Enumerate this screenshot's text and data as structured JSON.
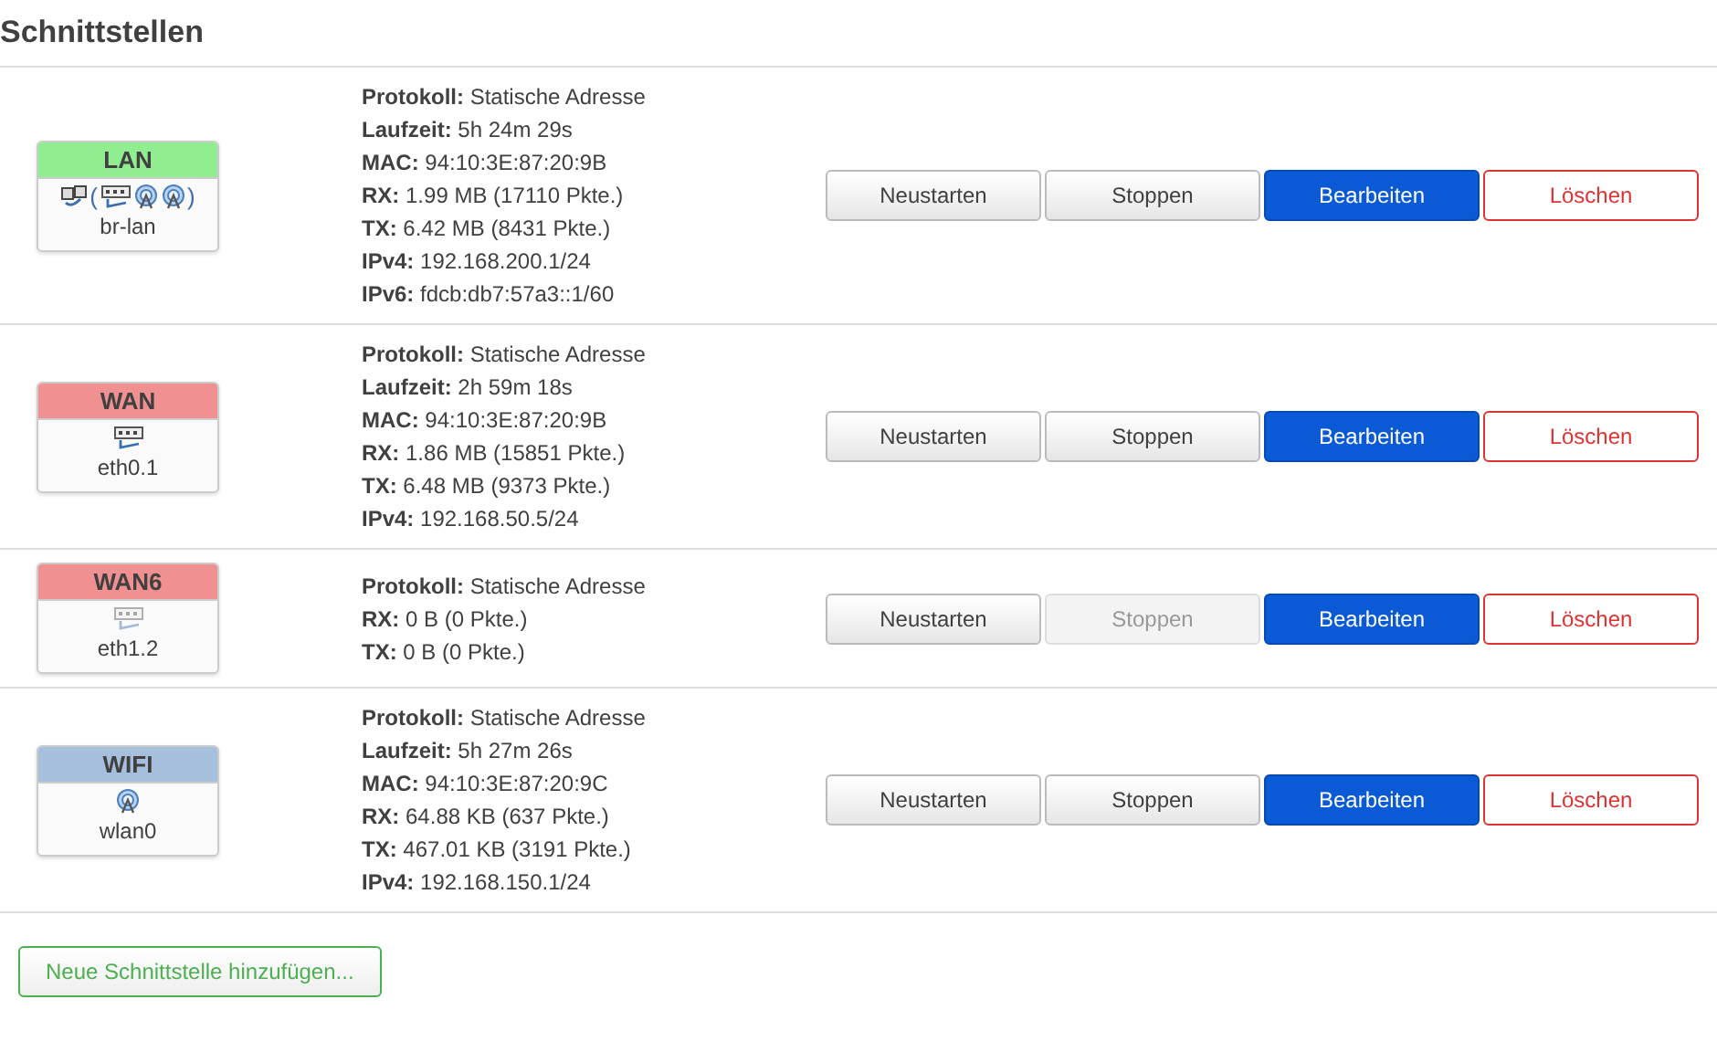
{
  "title": "Schnittstellen",
  "interfaces": [
    {
      "name": "LAN",
      "color": "#90ee90",
      "device": "br-lan",
      "icons": [
        {
          "kind": "bridge",
          "active": true
        },
        {
          "kind": "text",
          "text": "("
        },
        {
          "kind": "ethernet",
          "active": true
        },
        {
          "kind": "wifi",
          "active": true
        },
        {
          "kind": "wifi",
          "active": true
        },
        {
          "kind": "text",
          "text": ")"
        }
      ],
      "details": [
        {
          "label": "Protokoll:",
          "value": "Statische Adresse"
        },
        {
          "label": "Laufzeit:",
          "value": "5h 24m 29s"
        },
        {
          "label": "MAC:",
          "value": "94:10:3E:87:20:9B"
        },
        {
          "label": "RX:",
          "value": "1.99 MB (17110 Pkte.)"
        },
        {
          "label": "TX:",
          "value": "6.42 MB (8431 Pkte.)"
        },
        {
          "label": "IPv4:",
          "value": "192.168.200.1/24"
        },
        {
          "label": "IPv6:",
          "value": "fdcb:db7:57a3::1/60"
        }
      ],
      "buttons": [
        {
          "label": "Neustarten",
          "kind": "default",
          "disabled": false
        },
        {
          "label": "Stoppen",
          "kind": "default",
          "disabled": false
        },
        {
          "label": "Bearbeiten",
          "kind": "primary",
          "disabled": false
        },
        {
          "label": "Löschen",
          "kind": "danger",
          "disabled": false
        }
      ]
    },
    {
      "name": "WAN",
      "color": "#f09090",
      "device": "eth0.1",
      "icons": [
        {
          "kind": "ethernet",
          "active": true
        }
      ],
      "details": [
        {
          "label": "Protokoll:",
          "value": "Statische Adresse"
        },
        {
          "label": "Laufzeit:",
          "value": "2h 59m 18s"
        },
        {
          "label": "MAC:",
          "value": "94:10:3E:87:20:9B"
        },
        {
          "label": "RX:",
          "value": "1.86 MB (15851 Pkte.)"
        },
        {
          "label": "TX:",
          "value": "6.48 MB (9373 Pkte.)"
        },
        {
          "label": "IPv4:",
          "value": "192.168.50.5/24"
        }
      ],
      "buttons": [
        {
          "label": "Neustarten",
          "kind": "default",
          "disabled": false
        },
        {
          "label": "Stoppen",
          "kind": "default",
          "disabled": false
        },
        {
          "label": "Bearbeiten",
          "kind": "primary",
          "disabled": false
        },
        {
          "label": "Löschen",
          "kind": "danger",
          "disabled": false
        }
      ]
    },
    {
      "name": "WAN6",
      "color": "#f09090",
      "device": "eth1.2",
      "icons": [
        {
          "kind": "ethernet",
          "active": false
        }
      ],
      "details": [
        {
          "label": "Protokoll:",
          "value": "Statische Adresse"
        },
        {
          "label": "RX:",
          "value": "0 B (0 Pkte.)"
        },
        {
          "label": "TX:",
          "value": "0 B (0 Pkte.)"
        }
      ],
      "buttons": [
        {
          "label": "Neustarten",
          "kind": "default",
          "disabled": false
        },
        {
          "label": "Stoppen",
          "kind": "default",
          "disabled": true
        },
        {
          "label": "Bearbeiten",
          "kind": "primary",
          "disabled": false
        },
        {
          "label": "Löschen",
          "kind": "danger",
          "disabled": false
        }
      ]
    },
    {
      "name": "WIFI",
      "color": "#a5bfdd",
      "device": "wlan0",
      "icons": [
        {
          "kind": "wifi",
          "active": true
        }
      ],
      "details": [
        {
          "label": "Protokoll:",
          "value": "Statische Adresse"
        },
        {
          "label": "Laufzeit:",
          "value": "5h 27m 26s"
        },
        {
          "label": "MAC:",
          "value": "94:10:3E:87:20:9C"
        },
        {
          "label": "RX:",
          "value": "64.88 KB (637 Pkte.)"
        },
        {
          "label": "TX:",
          "value": "467.01 KB (3191 Pkte.)"
        },
        {
          "label": "IPv4:",
          "value": "192.168.150.1/24"
        }
      ],
      "buttons": [
        {
          "label": "Neustarten",
          "kind": "default",
          "disabled": false
        },
        {
          "label": "Stoppen",
          "kind": "default",
          "disabled": false
        },
        {
          "label": "Bearbeiten",
          "kind": "primary",
          "disabled": false
        },
        {
          "label": "Löschen",
          "kind": "danger",
          "disabled": false
        }
      ]
    }
  ],
  "add_button": "Neue Schnittstelle hinzufügen..."
}
